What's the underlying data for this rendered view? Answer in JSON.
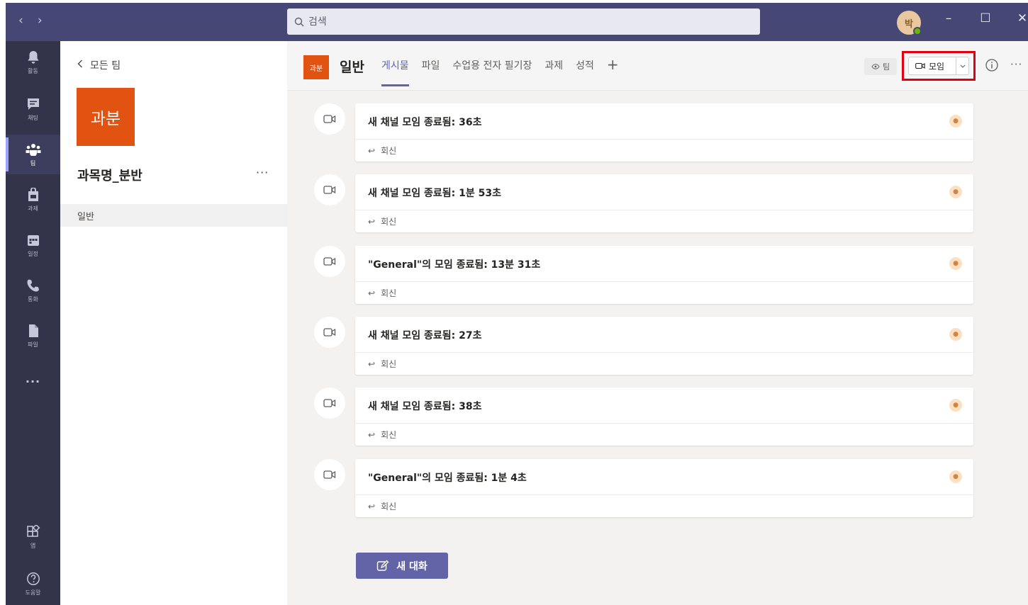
{
  "titlebar": {
    "back_glyph": "‹",
    "forward_glyph": "›",
    "search_placeholder": "검색",
    "avatar_initial": "박",
    "minimize_glyph": "–",
    "maximize_glyph": "☐",
    "close_glyph": "✕"
  },
  "rail": {
    "items": [
      {
        "label": "활동",
        "icon": "bell-icon"
      },
      {
        "label": "채팅",
        "icon": "chat-icon"
      },
      {
        "label": "팀",
        "icon": "teams-icon"
      },
      {
        "label": "과제",
        "icon": "assignments-icon"
      },
      {
        "label": "일정",
        "icon": "calendar-icon"
      },
      {
        "label": "통화",
        "icon": "phone-icon"
      },
      {
        "label": "파일",
        "icon": "file-icon"
      }
    ],
    "more": "···",
    "apps_label": "앱",
    "help_label": "도움말"
  },
  "teams_pane": {
    "back_label": "모든 팀",
    "team_tile": "과분",
    "team_name": "과목명_분반",
    "more": "···",
    "channels": [
      "일반"
    ]
  },
  "channel": {
    "tile": "과분",
    "name": "일반",
    "tabs": [
      {
        "label": "게시물",
        "active": true
      },
      {
        "label": "파일",
        "active": false
      },
      {
        "label": "수업용 전자 필기장",
        "active": false
      },
      {
        "label": "과제",
        "active": false
      },
      {
        "label": "성적",
        "active": false
      }
    ],
    "add_tab": "+",
    "team_pill": "팀",
    "meet_label": "모임",
    "more": "···"
  },
  "posts": [
    {
      "text": "새 채널 모임 종료됨: 36초",
      "reply": "회신"
    },
    {
      "text": "새 채널 모임 종료됨: 1분 53초",
      "reply": "회신"
    },
    {
      "text": "\"General\"의 모임 종료됨: 13분 31초",
      "reply": "회신"
    },
    {
      "text": "새 채널 모임 종료됨: 27초",
      "reply": "회신"
    },
    {
      "text": "새 채널 모임 종료됨: 38초",
      "reply": "회신"
    },
    {
      "text": "\"General\"의 모임 종료됨: 1분 4초",
      "reply": "회신"
    }
  ],
  "new_conversation": "새 대화",
  "colors": {
    "titlebar": "#464775",
    "rail": "#33344a",
    "accent": "#6264a7",
    "team_tile": "#e25312",
    "highlight_box": "#e00010"
  }
}
